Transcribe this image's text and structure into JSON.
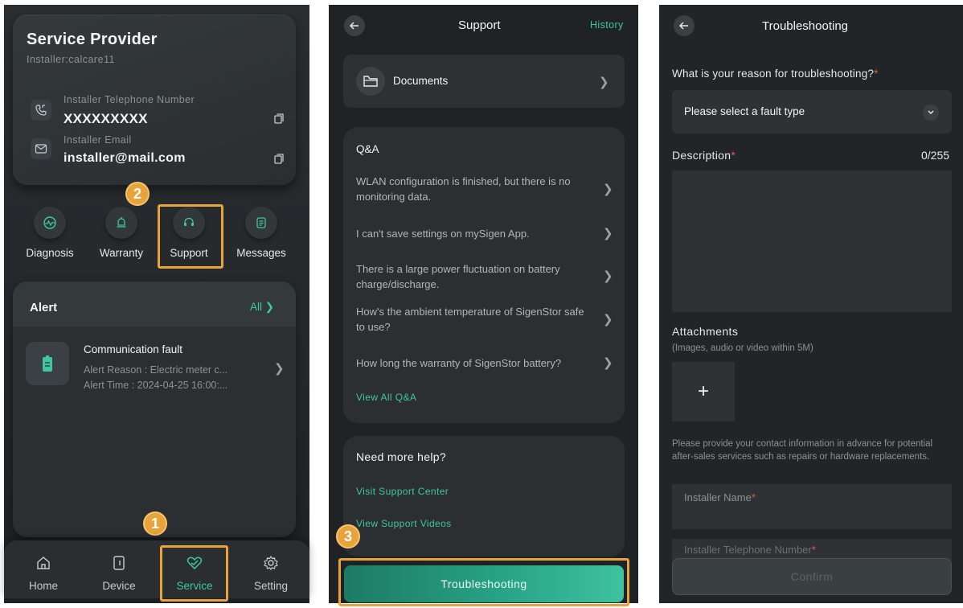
{
  "screen1": {
    "provider": {
      "title": "Service Provider",
      "subtitle": "Installer:calcare11",
      "phone_label": "Installer Telephone Number",
      "phone_value": "XXXXXXXXX",
      "email_label": "Installer Email",
      "email_value": "installer@mail.com"
    },
    "quick_actions": [
      {
        "label": "Diagnosis",
        "icon": "diagnosis-icon"
      },
      {
        "label": "Warranty",
        "icon": "warranty-bell-icon"
      },
      {
        "label": "Support",
        "icon": "headset-icon"
      },
      {
        "label": "Messages",
        "icon": "messages-icon"
      }
    ],
    "alert": {
      "title": "Alert",
      "all_label": "All",
      "item_title": "Communication fault",
      "reason": "Alert Reason : Electric meter c...",
      "time": "Alert Time : 2024-04-25 16:00:..."
    },
    "tabs": [
      {
        "label": "Home",
        "icon": "home-icon"
      },
      {
        "label": "Device",
        "icon": "device-icon"
      },
      {
        "label": "Service",
        "icon": "service-heart-icon"
      },
      {
        "label": "Setting",
        "icon": "gear-icon"
      }
    ],
    "badges": {
      "step1": "1",
      "step2": "2"
    }
  },
  "screen2": {
    "title": "Support",
    "history_label": "History",
    "documents_label": "Documents",
    "qa_title": "Q&A",
    "qa_items": [
      "WLAN configuration is finished, but there is no monitoring data.",
      "I can't save settings on mySigen App.",
      "There is a large power fluctuation on battery charge/discharge.",
      "How's the ambient temperature of SigenStor safe to use?",
      "How long the warranty of SigenStor battery?"
    ],
    "qa_view_all": "View All Q&A",
    "help_title": "Need more help?",
    "help_links": [
      "Visit Support Center",
      "View Support Videos"
    ],
    "troubleshooting_label": "Troubleshooting",
    "badge": "3"
  },
  "screen3": {
    "title": "Troubleshooting",
    "question": "What is your reason for troubleshooting?",
    "select_placeholder": "Please select a fault type",
    "description_label": "Description",
    "description_count": "0/255",
    "attachments_label": "Attachments",
    "attachments_sub": "(Images, audio or video within 5M)",
    "add_symbol": "+",
    "contact_note": "Please provide your contact information in advance for potential after-sales services such as repairs or hardware replacements.",
    "installer_name_placeholder": "Installer Name",
    "installer_phone_placeholder": "Installer Telephone Number",
    "confirm_label": "Confirm"
  },
  "colors": {
    "accent": "#3fc7a0",
    "highlight": "#e8a33a",
    "required": "#e8584b"
  }
}
